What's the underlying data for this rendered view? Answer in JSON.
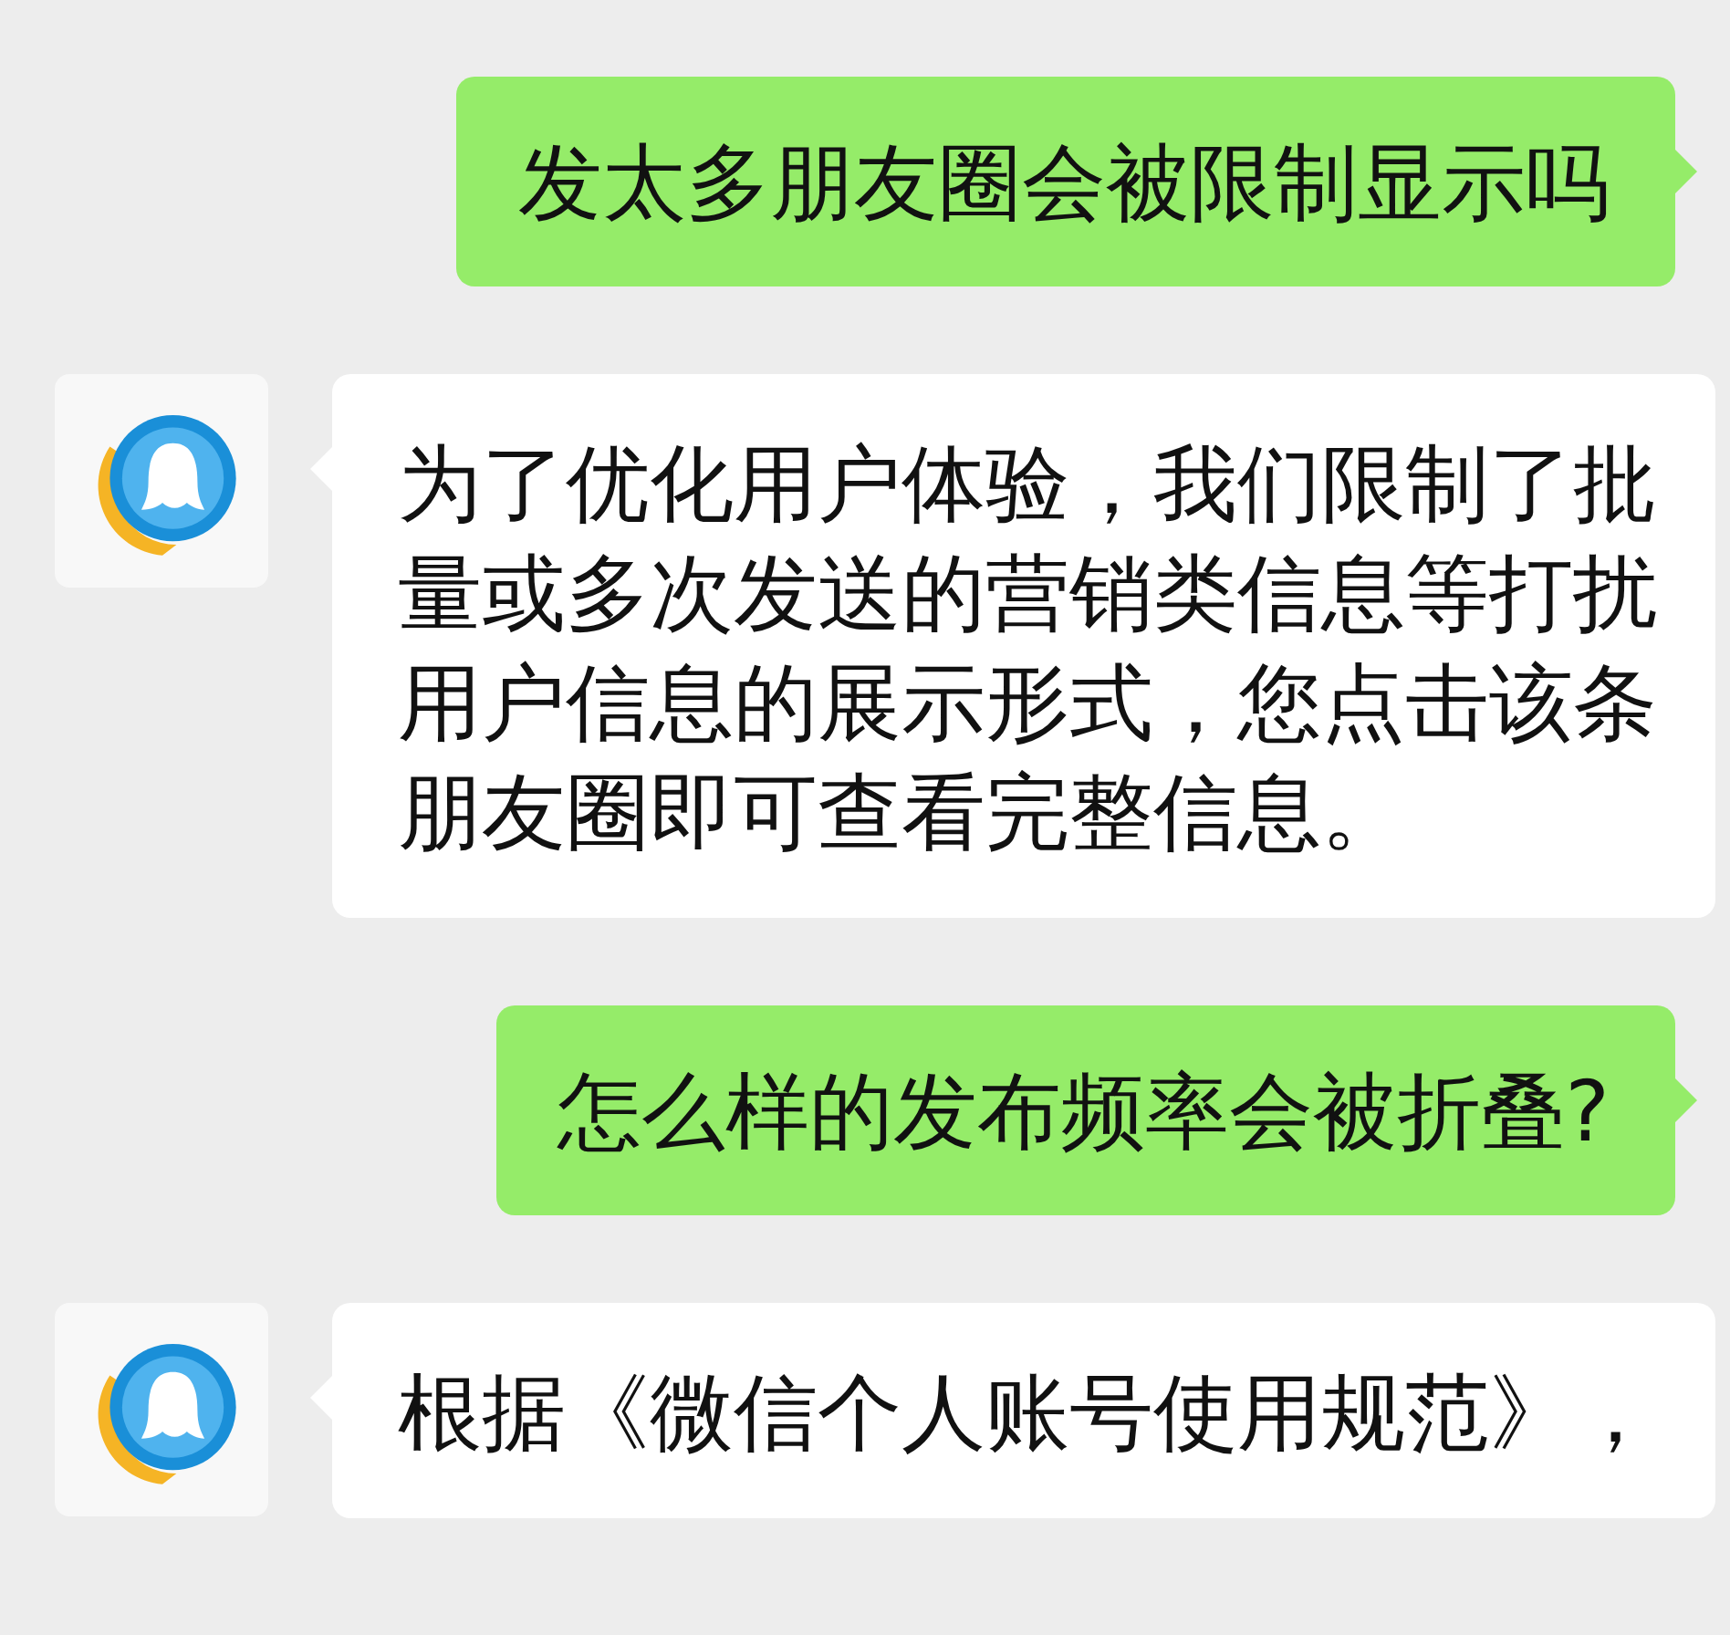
{
  "messages": [
    {
      "kind": "sent",
      "text": "发太多朋友圈会被限制显示吗"
    },
    {
      "kind": "received",
      "text": "为了优化用户体验，我们限制了批量或多次发送的营销类信息等打扰用户信息的展示形式，您点击该条朋友圈即可查看完整信息。"
    },
    {
      "kind": "sent",
      "text": "怎么样的发布频率会被折叠?"
    },
    {
      "kind": "received",
      "text": "根据《微信个人账号使用规范》，"
    }
  ]
}
